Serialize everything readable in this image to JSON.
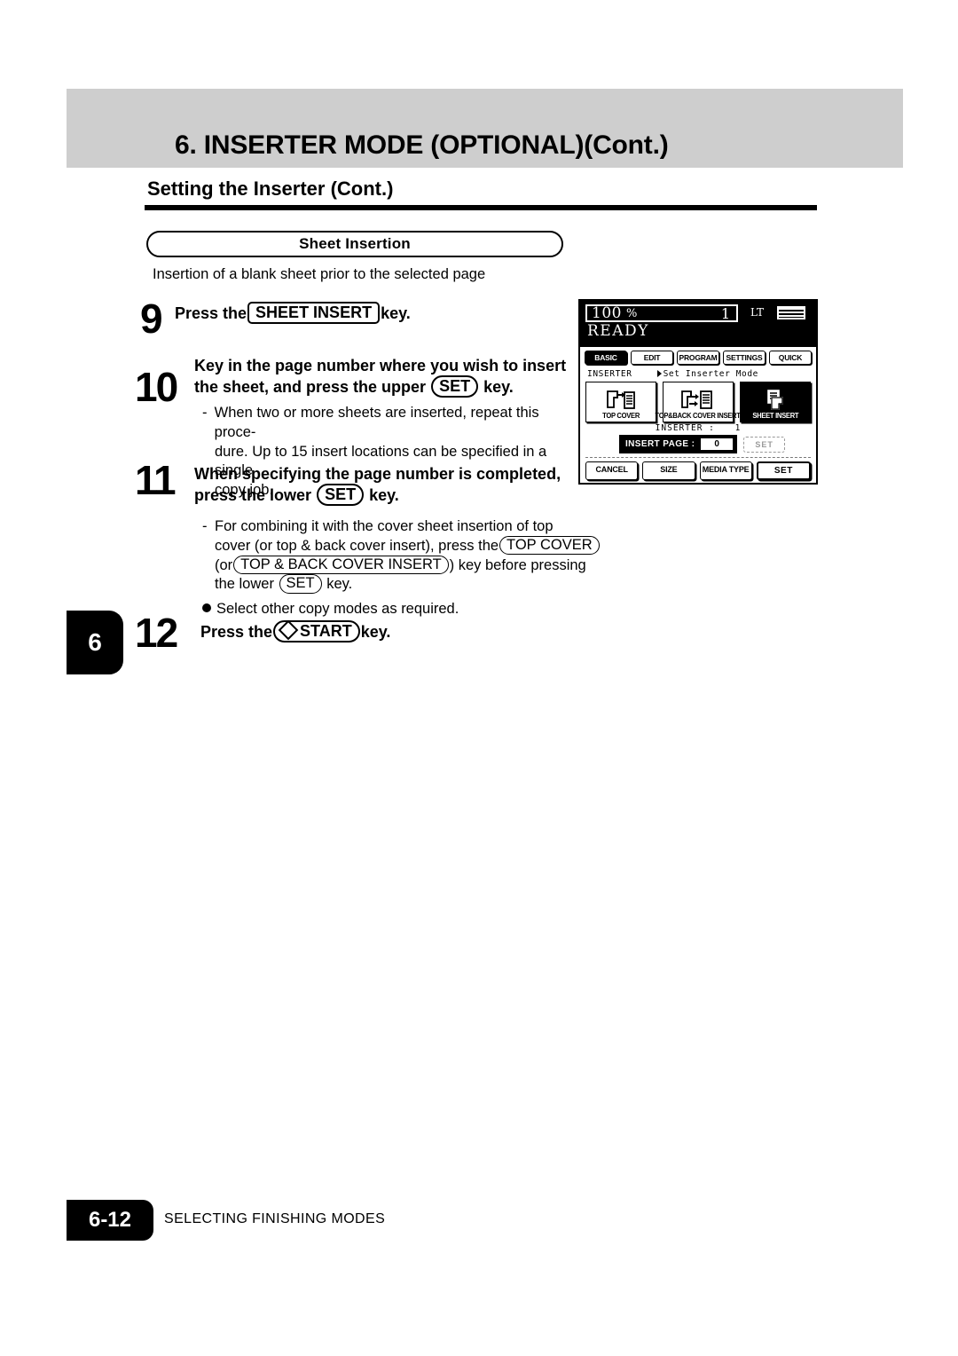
{
  "header": {
    "title": "6. INSERTER MODE (OPTIONAL)(Cont.)",
    "subtitle": "Setting the Inserter (Cont.)"
  },
  "section": {
    "pill_label": "Sheet Insertion",
    "intro": "Insertion of a blank sheet prior to the selected page"
  },
  "steps": {
    "s9": {
      "num": "9",
      "text_before": "Press the",
      "key": "SHEET INSERT",
      "text_after": "key."
    },
    "s10": {
      "num": "10",
      "line1": "Key in the page number where you wish to insert",
      "line2_before": "the sheet, and press the upper",
      "key": "SET",
      "line2_after": "key.",
      "note_dash": "-",
      "note_l1": "When two or more sheets are inserted, repeat  this proce-",
      "note_l2": "dure. Up to 15 insert locations can be specified in a single",
      "note_l3": "copy job."
    },
    "s11": {
      "num": "11",
      "line1": "When specifying the page number is completed,",
      "line2_before": "press the  lower",
      "key": "SET",
      "line2_after": "key.",
      "note_dash": "-",
      "note_l1": "For combining it with the cover sheet insertion of top",
      "note_l2a": "cover (or top & back cover insert), press the",
      "note_l2_key": "TOP COVER",
      "note_l3a": "(or",
      "note_l3_key": "TOP & BACK COVER INSERT",
      "note_l3b": ") key before pressing",
      "note_l4a": "the lower",
      "note_l4_key": "SET",
      "note_l4b": "key.",
      "bullet": "Select other copy modes as required."
    },
    "s12": {
      "num": "12",
      "text_before": "Press the",
      "key_icon": "start-diamond-icon",
      "key": "START",
      "text_after": "key."
    }
  },
  "side_tab": {
    "chapter": "6"
  },
  "lcd": {
    "zoom": "100",
    "percent": "%",
    "copies": "1",
    "paper_label": "LT",
    "status": "READY",
    "tabs": [
      {
        "label": "BASIC",
        "active": true
      },
      {
        "label": "EDIT",
        "active": false
      },
      {
        "label": "PROGRAM",
        "active": false
      },
      {
        "label": "SETTINGS",
        "active": false
      },
      {
        "label": "QUICK",
        "active": false
      }
    ],
    "breadcrumb_left": "INSERTER",
    "breadcrumb_right": "Set Inserter Mode",
    "modes": [
      {
        "label": "TOP COVER",
        "selected": false
      },
      {
        "label": "TOP&BACK COVER INSERT",
        "selected": false
      },
      {
        "label": "SHEET INSERT",
        "selected": true
      }
    ],
    "inserter_row_label": "INSERTER  :",
    "inserter_row_value": "1",
    "insert_page_label": "INSERT PAGE  :",
    "insert_page_value": "0",
    "insert_page_set": "SET",
    "bottom_buttons": [
      {
        "label": "CANCEL",
        "strong": false
      },
      {
        "label": "SIZE",
        "strong": false
      },
      {
        "label": "MEDIA TYPE",
        "strong": false
      },
      {
        "label": "SET",
        "strong": true
      }
    ]
  },
  "footer": {
    "page": "6-12",
    "section_name": "SELECTING FINISHING MODES"
  }
}
